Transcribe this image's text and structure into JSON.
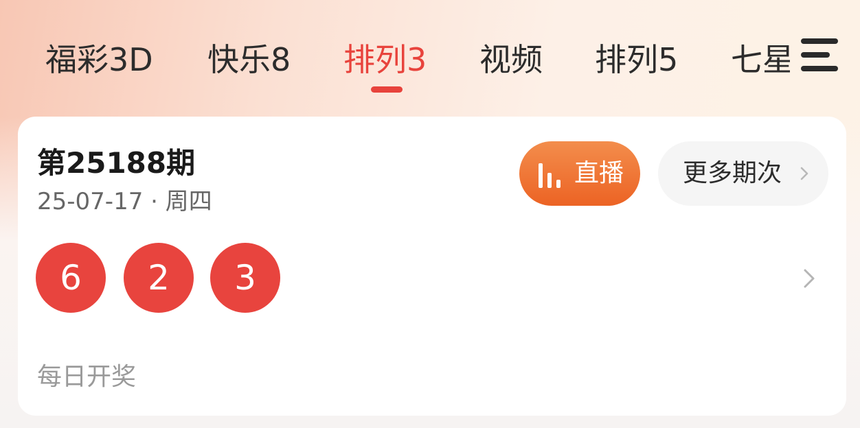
{
  "tabs": [
    {
      "label": "福彩3D",
      "active": false
    },
    {
      "label": "快乐8",
      "active": false
    },
    {
      "label": "排列3",
      "active": true
    },
    {
      "label": "视频",
      "active": false
    },
    {
      "label": "排列5",
      "active": false
    },
    {
      "label": "七星彩",
      "active": false
    }
  ],
  "menu_icon": "hamburger-menu-icon",
  "card": {
    "issue": "第25188期",
    "date": "25-07-17 · 周四",
    "live_button": {
      "icon": "bar-chart-icon",
      "label": "直播"
    },
    "more_button": {
      "label": "更多期次",
      "icon": "chevron-right-icon"
    },
    "numbers": [
      "6",
      "2",
      "3"
    ],
    "draw_frequency": "每日开奖"
  },
  "colors": {
    "accent_red": "#e8433c",
    "ball_red": "#e8443e",
    "live_orange": "#ec6324",
    "text_dark": "#1a1a1a",
    "text_gray": "#9a9a9a"
  }
}
